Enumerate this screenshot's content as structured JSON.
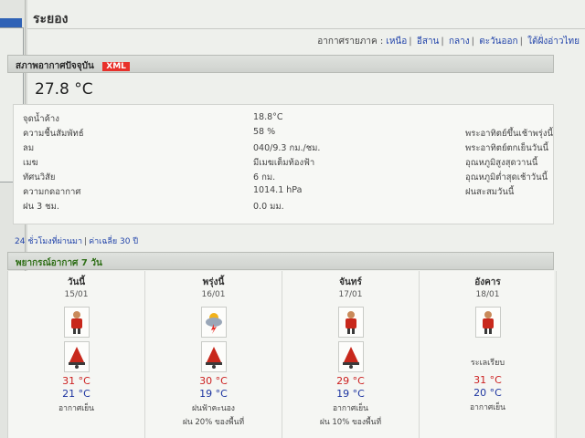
{
  "page": {
    "title": "ระยอง"
  },
  "region_nav": {
    "prefix": "อากาศรายภาค :",
    "links": [
      "เหนือ",
      "อีสาน",
      "กลาง",
      "ตะวันออก",
      "ใต้ฝั่งอ่าวไทย"
    ]
  },
  "current": {
    "header": "สภาพอากาศปัจจุบัน",
    "xml_badge": "XML",
    "temperature": "27.8 °C",
    "rows": [
      {
        "label": "จุดน้ำค้าง",
        "value": "18.8°C"
      },
      {
        "label": "ความชื้นสัมพัทธ์",
        "value": "58 %"
      },
      {
        "label": "ลม",
        "value": "040/9.3 กม./ชม."
      },
      {
        "label": "เมฆ",
        "value": "มีเมฆเต็มท้องฟ้า"
      },
      {
        "label": "ทัศนวิสัย",
        "value": "6 กม."
      },
      {
        "label": "ความกดอากาศ",
        "value": "1014.1 hPa"
      },
      {
        "label": "ฝน 3 ชม.",
        "value": "0.0 มม."
      }
    ],
    "side_labels": [
      "พระอาทิตย์ขึ้นเช้าพรุ่งนี้",
      "พระอาทิตย์ตกเย็นวันนี้",
      "อุณหภูมิสูงสุดวานนี้",
      "อุณหภูมิต่ำสุดเช้าวันนี้",
      "ฝนสะสมวันนี้"
    ]
  },
  "history_links": {
    "recent": "24 ชั่วโมงที่ผ่านมา",
    "average": "ค่าเฉลี่ย 30 ปี"
  },
  "forecast": {
    "header": "พยากรณ์อากาศ 7 วัน",
    "days": [
      {
        "day": "วันนี้",
        "date": "15/01",
        "icon1": "person-cold-icon",
        "icon2": "bell-icon",
        "mid_desc": "",
        "max": "31 °C",
        "min": "21 °C",
        "desc": "อากาศเย็น",
        "rain": ""
      },
      {
        "day": "พรุ่งนี้",
        "date": "16/01",
        "icon1": "thunderstorm-icon",
        "icon2": "bell-icon",
        "mid_desc": "",
        "max": "30 °C",
        "min": "19 °C",
        "desc": "ฝนฟ้าคะนอง",
        "rain": "ฝน 20% ของพื้นที่"
      },
      {
        "day": "จันทร์",
        "date": "17/01",
        "icon1": "person-cold-icon",
        "icon2": "bell-icon",
        "mid_desc": "",
        "max": "29 °C",
        "min": "19 °C",
        "desc": "อากาศเย็น",
        "rain": "ฝน 10% ของพื้นที่"
      },
      {
        "day": "อังคาร",
        "date": "18/01",
        "icon1": "person-cold-icon",
        "icon2": "",
        "mid_desc": "ระเลเรียบ",
        "max": "31 °C",
        "min": "20 °C",
        "desc": "อากาศเย็น",
        "rain": ""
      }
    ]
  },
  "colors": {
    "max_temp": "#cc1f1f",
    "min_temp": "#1d35a0",
    "link": "#2244aa",
    "badge": "#e8302a"
  }
}
